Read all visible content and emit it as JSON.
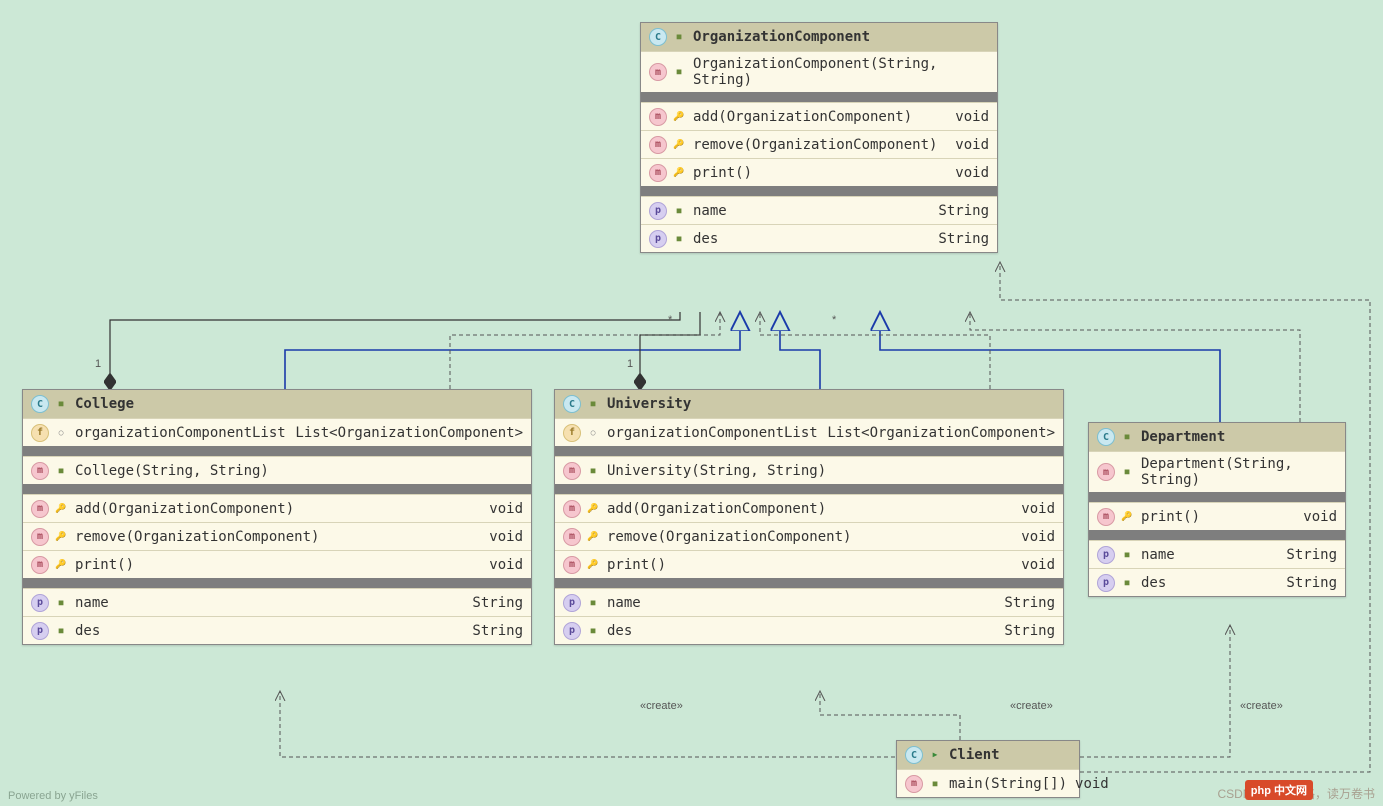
{
  "diagram": {
    "classes": {
      "organizationComponent": {
        "name": "OrganizationComponent",
        "constructor": "OrganizationComponent(String, String)",
        "methods": [
          {
            "sig": "add(OrganizationComponent)",
            "ret": "void"
          },
          {
            "sig": "remove(OrganizationComponent)",
            "ret": "void"
          },
          {
            "sig": "print()",
            "ret": "void"
          }
        ],
        "props": [
          {
            "n": "name",
            "t": "String"
          },
          {
            "n": "des",
            "t": "String"
          }
        ]
      },
      "college": {
        "name": "College",
        "field": {
          "n": "organizationComponentList",
          "t": "List<OrganizationComponent>"
        },
        "constructor": "College(String, String)",
        "methods": [
          {
            "sig": "add(OrganizationComponent)",
            "ret": "void"
          },
          {
            "sig": "remove(OrganizationComponent)",
            "ret": "void"
          },
          {
            "sig": "print()",
            "ret": "void"
          }
        ],
        "props": [
          {
            "n": "name",
            "t": "String"
          },
          {
            "n": "des",
            "t": "String"
          }
        ]
      },
      "university": {
        "name": "University",
        "field": {
          "n": "organizationComponentList",
          "t": "List<OrganizationComponent>"
        },
        "constructor": "University(String, String)",
        "methods": [
          {
            "sig": "add(OrganizationComponent)",
            "ret": "void"
          },
          {
            "sig": "remove(OrganizationComponent)",
            "ret": "void"
          },
          {
            "sig": "print()",
            "ret": "void"
          }
        ],
        "props": [
          {
            "n": "name",
            "t": "String"
          },
          {
            "n": "des",
            "t": "String"
          }
        ]
      },
      "department": {
        "name": "Department",
        "constructor": "Department(String, String)",
        "methods": [
          {
            "sig": "print()",
            "ret": "void"
          }
        ],
        "props": [
          {
            "n": "name",
            "t": "String"
          },
          {
            "n": "des",
            "t": "String"
          }
        ]
      },
      "client": {
        "name": "Client",
        "main": {
          "sig": "main(String[])",
          "ret": "void"
        }
      }
    },
    "labels": {
      "create": "«create»",
      "one": "1",
      "many": "*"
    },
    "footer_left": "Powered by yFiles",
    "footer_right_author": "CSDN @行万里路，读万卷书",
    "footer_brand": "php 中文网"
  }
}
